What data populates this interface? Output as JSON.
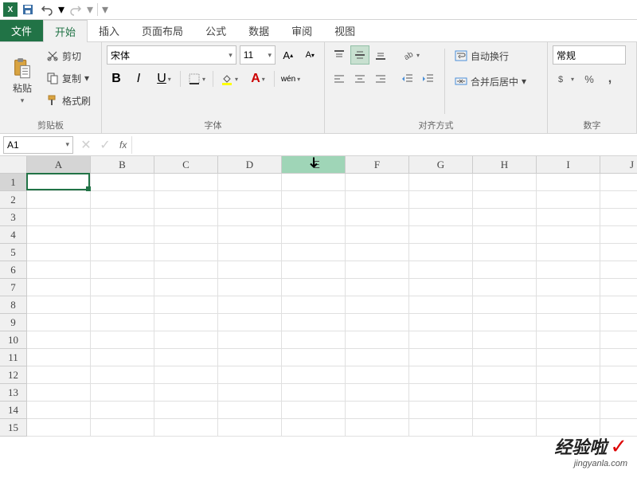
{
  "qat": {
    "save": "保存",
    "undo": "撤销",
    "redo": "重做"
  },
  "tabs": {
    "file": "文件",
    "home": "开始",
    "insert": "插入",
    "layout": "页面布局",
    "formulas": "公式",
    "data": "数据",
    "review": "审阅",
    "view": "视图"
  },
  "clipboard": {
    "paste": "粘贴",
    "cut": "剪切",
    "copy": "复制",
    "format_painter": "格式刷",
    "group": "剪贴板"
  },
  "font": {
    "name": "宋体",
    "size": "11",
    "bold": "B",
    "italic": "I",
    "underline": "U",
    "group": "字体"
  },
  "alignment": {
    "wrap": "自动换行",
    "merge": "合并后居中",
    "group": "对齐方式"
  },
  "number": {
    "format": "常规",
    "percent": "%",
    "comma": ",",
    "group": "数字"
  },
  "namebox": "A1",
  "fx": "fx",
  "columns": [
    "A",
    "B",
    "C",
    "D",
    "E",
    "F",
    "G",
    "H",
    "I",
    "J"
  ],
  "rows": [
    "1",
    "2",
    "3",
    "4",
    "5",
    "6",
    "7",
    "8",
    "9",
    "10",
    "11",
    "12",
    "13",
    "14",
    "15"
  ],
  "active_cell": {
    "col": 0,
    "row": 0
  },
  "hover_col": 4,
  "watermark": {
    "main": "经验啦",
    "check": "✓",
    "sub": "jingyanla.com"
  }
}
